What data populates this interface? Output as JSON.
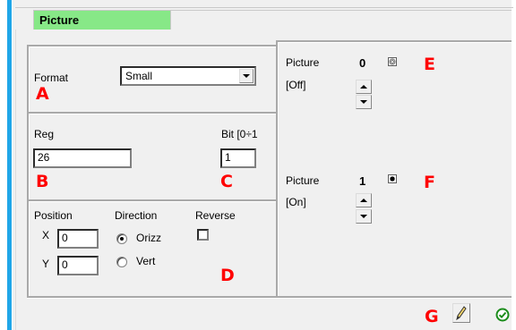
{
  "tab": {
    "label": "Picture"
  },
  "format": {
    "label": "Format",
    "selected": "Small",
    "marker": "A"
  },
  "reg": {
    "label": "Reg",
    "value": "26",
    "marker": "B"
  },
  "bit": {
    "label": "Bit [0÷1",
    "value": "1",
    "marker": "C"
  },
  "position": {
    "label": "Position",
    "x_label": "X",
    "x_value": "0",
    "y_label": "Y",
    "y_value": "0"
  },
  "direction": {
    "label": "Direction",
    "options": [
      "Orizz",
      "Vert"
    ],
    "selected": "Orizz"
  },
  "reverse": {
    "label": "Reverse",
    "checked": false,
    "marker": "D"
  },
  "pictures": [
    {
      "label": "Picture",
      "index": "0",
      "state": "[Off]",
      "marker": "E"
    },
    {
      "label": "Picture",
      "index": "1",
      "state": "[On]",
      "marker": "F"
    }
  ],
  "footer": {
    "marker": "G",
    "edit_icon": "pencil-icon",
    "ok_icon": "check-circle-icon"
  },
  "colors": {
    "tab_active": "#87e887",
    "accent_stripe": "#1fa6e8",
    "marker": "#ff0000",
    "ok": "#1a8c1a"
  }
}
